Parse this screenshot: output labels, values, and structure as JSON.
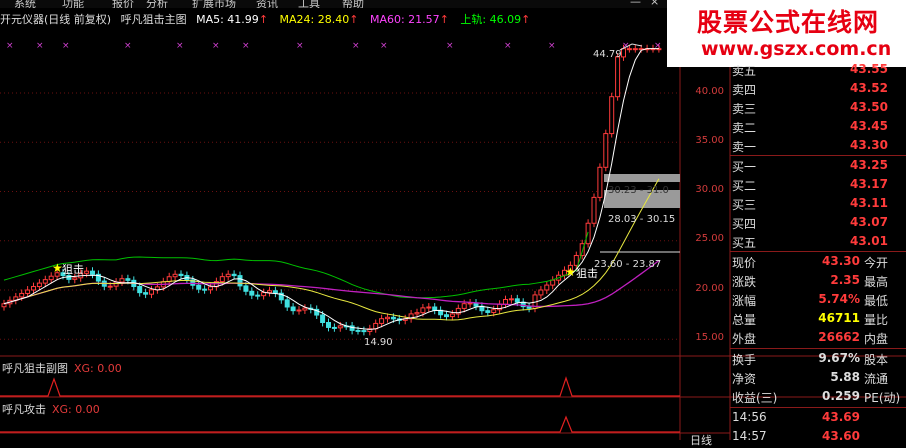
{
  "menubar": {
    "items": [
      "系统",
      "功能",
      "报价",
      "分析",
      "扩展市场",
      "资讯",
      "工具",
      "帮助"
    ]
  },
  "toolbar": {
    "min_icon": "—",
    "close_icon": "×"
  },
  "watermark": {
    "line1": "股票公式在线网",
    "line2": "www.gszx.com.cn"
  },
  "title": {
    "stock": "开元仪器(日线 前复权)",
    "indicator": "呼凡狙击主图",
    "ma5": "MA5: 41.99",
    "ma24": "MA24: 28.40",
    "ma60": "MA60: 21.57",
    "upper": "上轨: 46.09",
    "colors": {
      "ma5": "#ffffff",
      "ma24": "#ffff00",
      "ma60": "#ff00ff",
      "upper": "#00ff00"
    }
  },
  "yaxis": {
    "labels": [
      "40.00",
      "35.00",
      "30.00",
      "25.00",
      "20.00",
      "15.00"
    ]
  },
  "annotations": {
    "high": "44.79",
    "low": "14.90",
    "range1": "23.60 - 23.87",
    "range2": "28.03 - 30.15",
    "range3": "30.23 - 31.0",
    "signal1": "狙击",
    "signal2": "狙击"
  },
  "sub1": {
    "title": "呼凡狙击副图",
    "value": "XG: 0.00"
  },
  "sub2": {
    "title": "呼凡攻击",
    "value": "XG: 0.00"
  },
  "sub_right": "日线",
  "orderbook": {
    "sell": [
      {
        "label": "卖五",
        "price": "43.55"
      },
      {
        "label": "卖四",
        "price": "43.52"
      },
      {
        "label": "卖三",
        "price": "43.50"
      },
      {
        "label": "卖二",
        "price": "43.45"
      },
      {
        "label": "卖一",
        "price": "43.30"
      }
    ],
    "buy": [
      {
        "label": "买一",
        "price": "43.25"
      },
      {
        "label": "买二",
        "price": "43.17"
      },
      {
        "label": "买三",
        "price": "43.11"
      },
      {
        "label": "买四",
        "price": "43.07"
      },
      {
        "label": "买五",
        "price": "43.01"
      }
    ]
  },
  "quote": [
    {
      "label": "现价",
      "value": "43.30",
      "right": "今开",
      "color": "#ff3b3b"
    },
    {
      "label": "涨跌",
      "value": "2.35",
      "right": "最高",
      "color": "#ff3b3b"
    },
    {
      "label": "涨幅",
      "value": "5.74%",
      "right": "最低",
      "color": "#ff3b3b"
    },
    {
      "label": "总量",
      "value": "46711",
      "right": "量比",
      "color": "#ffff00"
    },
    {
      "label": "外盘",
      "value": "26662",
      "right": "内盘",
      "color": "#ff3b3b"
    },
    {
      "label": "换手",
      "value": "9.67%",
      "right": "股本",
      "color": "#dddddd"
    },
    {
      "label": "净资",
      "value": "5.88",
      "right": "流通",
      "color": "#dddddd"
    },
    {
      "label": "收益(三)",
      "value": "0.259",
      "right": "PE(动)",
      "color": "#dddddd"
    }
  ],
  "ticks": [
    {
      "time": "14:56",
      "price": "43.69"
    },
    {
      "time": "14:57",
      "price": "43.60"
    }
  ]
}
